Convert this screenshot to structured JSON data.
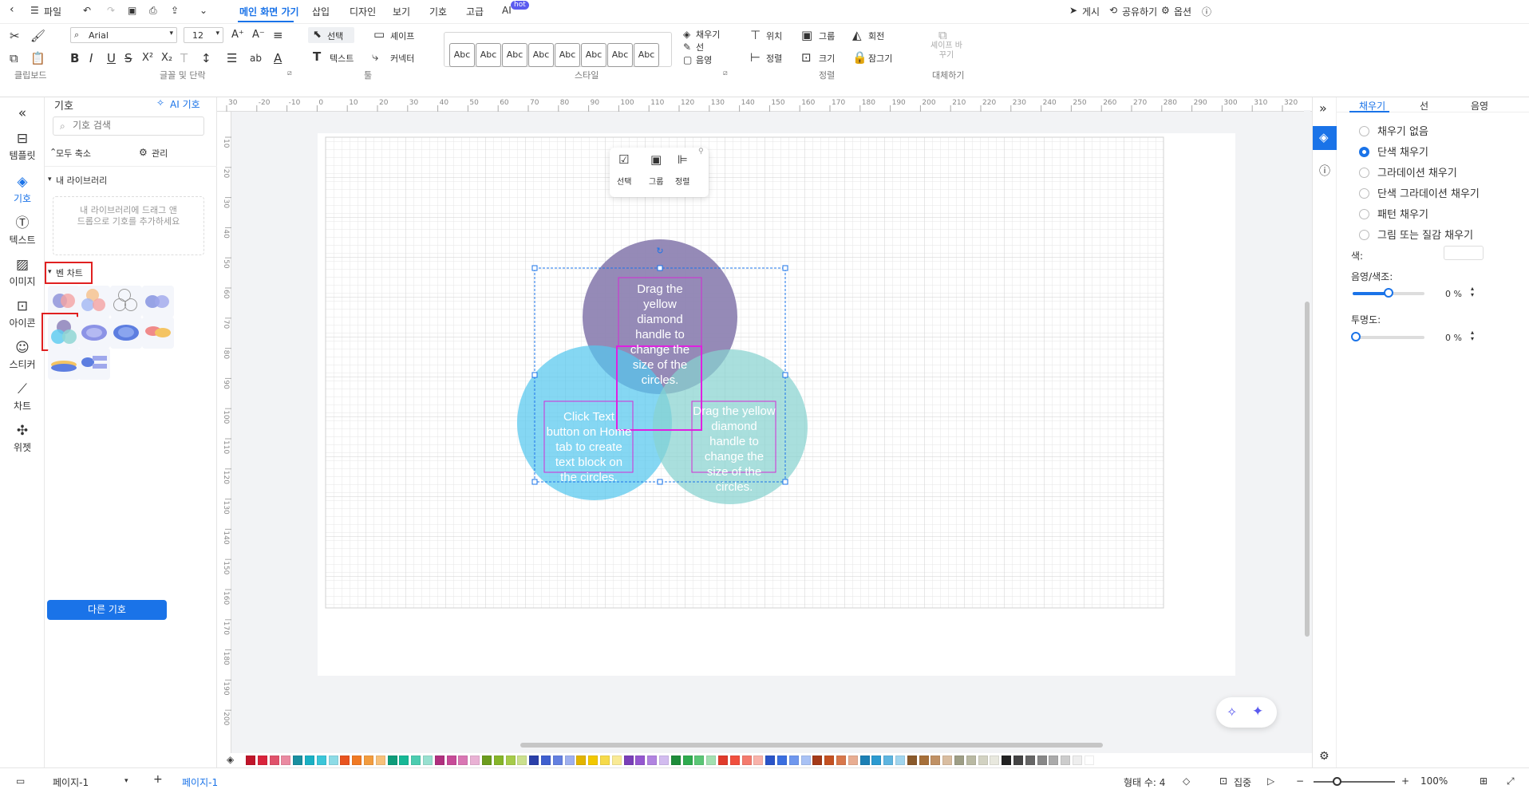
{
  "topbar": {
    "file": "파일",
    "tabs": [
      "메인 화면 가기",
      "삽입",
      "디자인",
      "보기",
      "기호",
      "고급",
      "AI"
    ],
    "hot_badge": "hot",
    "publish": "게시",
    "share": "공유하기",
    "options": "옵션"
  },
  "ribbon": {
    "font_name": "Arial",
    "font_size": "12",
    "group_labels": {
      "clipboard": "클립보드",
      "font": "글꼴 및 단락",
      "tools": "툴",
      "style": "스타일",
      "arrange": "정렬",
      "replace": "대체하기"
    },
    "tools": {
      "select": "선택",
      "shape": "셰이프",
      "text": "텍스트",
      "connector": "커넥터"
    },
    "style_items": [
      "Abc",
      "Abc",
      "Abc",
      "Abc",
      "Abc",
      "Abc",
      "Abc",
      "Abc"
    ],
    "fill": "채우기",
    "line": "선",
    "shadow": "음영",
    "position": "위치",
    "group": "그룹",
    "rotate": "회전",
    "align": "정렬",
    "size": "크기",
    "lock": "잠그기",
    "replace_shape": "셰이프 바꾸기"
  },
  "leftnav": [
    {
      "icon": "template-icon",
      "label": "템플릿"
    },
    {
      "icon": "symbol-icon",
      "label": "기호"
    },
    {
      "icon": "text-icon",
      "label": "텍스트"
    },
    {
      "icon": "image-icon",
      "label": "이미지"
    },
    {
      "icon": "icon-icon",
      "label": "아이콘"
    },
    {
      "icon": "sticker-icon",
      "label": "스티커"
    },
    {
      "icon": "chart-icon",
      "label": "차트"
    },
    {
      "icon": "widget-icon",
      "label": "위젯"
    }
  ],
  "sympanel": {
    "title": "기호",
    "ai": "AI 기호",
    "search_placeholder": "기호 검색",
    "collapse": "모두 축소",
    "manage": "관리",
    "mylib": "내 라이브러리",
    "mylib_hint": "내 라이브러리에 드래그 앤 드롭으로 기호를 추가하세요",
    "venn": "벤 차트",
    "more": "다른 기호"
  },
  "ruler_top": [
    "30",
    "-20",
    "-10",
    "0",
    "10",
    "20",
    "30",
    "40",
    "50",
    "60",
    "70",
    "80",
    "90",
    "100",
    "110",
    "120",
    "130",
    "140",
    "150",
    "160",
    "170",
    "180",
    "190",
    "200",
    "210",
    "220",
    "230",
    "240",
    "250",
    "260",
    "270",
    "280",
    "290",
    "300",
    "310",
    "320"
  ],
  "ruler_left": [
    "10",
    "20",
    "30",
    "40",
    "50",
    "60",
    "70",
    "80",
    "90",
    "100",
    "110",
    "120",
    "130",
    "140",
    "150",
    "160",
    "170",
    "180",
    "190",
    "200"
  ],
  "float_toolbar": {
    "select": "선택",
    "group": "그룹",
    "align": "정렬"
  },
  "venn": {
    "top_text": "Drag the yellow diamond handle to change the size of the circles.",
    "left_text": "Click Text button on Home tab to create text block on the circles.",
    "right_text": "Drag the yellow diamond handle to change the size of the circles.",
    "colors": {
      "top": "#8f84b3",
      "left": "#56c8ee",
      "right": "#88d3d0"
    }
  },
  "rightpanel": {
    "tabs": [
      "채우기",
      "선",
      "음영"
    ],
    "fill_options": [
      "채우기 없음",
      "단색 채우기",
      "그라데이션 채우기",
      "단색 그라데이션 채우기",
      "패턴 채우기",
      "그림 또는 질감 채우기"
    ],
    "selected": 1,
    "color_label": "색:",
    "shade_label": "음영/색조:",
    "shade_value": "0 %",
    "transparency_label": "투명도:",
    "transparency_value": "0 %"
  },
  "palette": [
    "#c0152a",
    "#d9243c",
    "#e0526b",
    "#ea8aa1",
    "#1a8fa0",
    "#1ab0c4",
    "#3cc6d9",
    "#8ddbe6",
    "#e8531f",
    "#f07a24",
    "#f29c3f",
    "#f7c07a",
    "#0e9c7a",
    "#17b896",
    "#4cccb0",
    "#98e0d0",
    "#b0307f",
    "#c74b98",
    "#d977b4",
    "#e9b1d4",
    "#6c9c1e",
    "#86b52a",
    "#a6cb4a",
    "#cbe08e",
    "#2a3fa8",
    "#3f5fcf",
    "#6480e0",
    "#9fb0ee",
    "#e2b400",
    "#f2c800",
    "#f6da4a",
    "#f9ea95",
    "#7a3fb8",
    "#9557d0",
    "#b184e0",
    "#d2bcef",
    "#1e8c3a",
    "#2fab4f",
    "#5bc676",
    "#a3e0b1",
    "#e03b2c",
    "#f04f3e",
    "#f47b6e",
    "#f8b2aa",
    "#2a54c8",
    "#3b6fe0",
    "#6f97ee",
    "#a9c2f5",
    "#a43a18",
    "#c45122",
    "#d8784c",
    "#e8ad92",
    "#1b7fb4",
    "#2c9ad0",
    "#5eb5e0",
    "#a1d5ee",
    "#8a5a2b",
    "#a66f39",
    "#c09165",
    "#d9bda0",
    "#9e9e86",
    "#b9b9a3",
    "#d2d2c2",
    "#e8e8de",
    "#222222",
    "#444444",
    "#666666",
    "#888888",
    "#aaaaaa",
    "#cccccc",
    "#eeeeee",
    "#ffffff"
  ],
  "statusbar": {
    "page_select": "페이지-1",
    "page_tab": "페이지-1",
    "shape_count": "형태 수: 4",
    "focus": "집중",
    "zoom": "100%"
  }
}
